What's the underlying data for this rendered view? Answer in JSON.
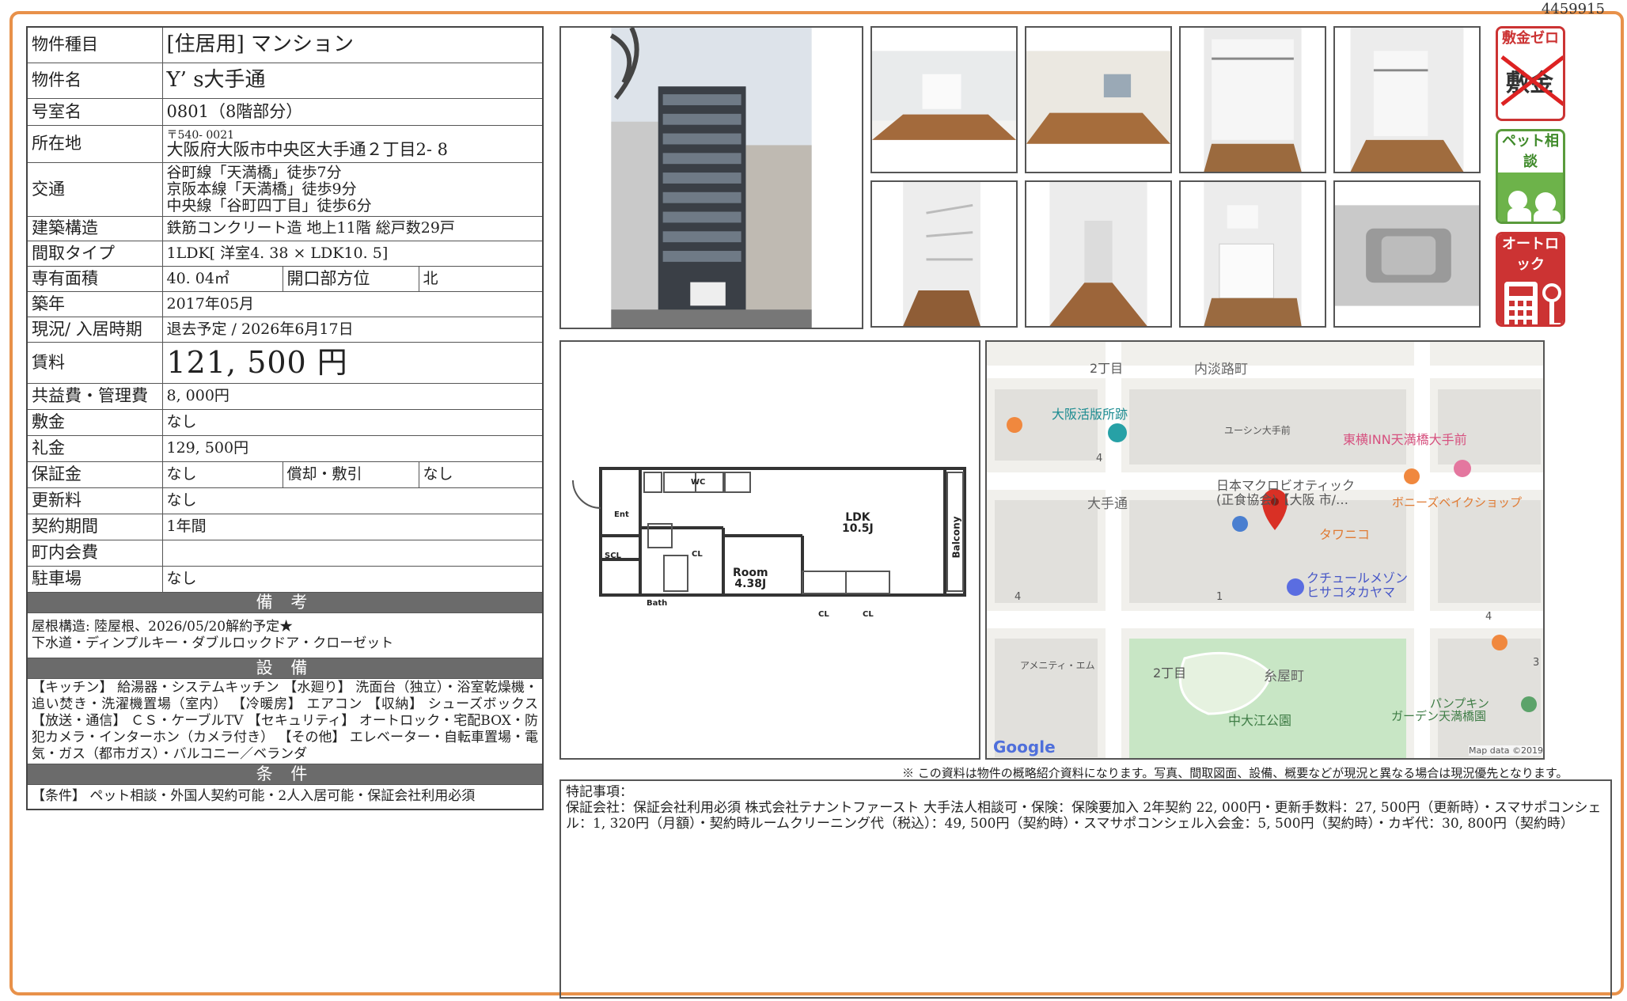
{
  "doc_id": "4459915",
  "property": {
    "type_label": "物件種目",
    "type_value": "[住居用] マンション",
    "name_label": "物件名",
    "name_value": "Y’ s大手通",
    "room_label": "号室名",
    "room_value": "0801（8階部分）",
    "address_label": "所在地",
    "postal": "〒540- 0021",
    "address": "大阪府大阪市中央区大手通２丁目2- 8",
    "transport_label": "交通",
    "transport": [
      "谷町線「天満橋」徒歩7分",
      "京阪本線「天満橋」徒歩9分",
      "中央線「谷町四丁目」徒歩6分"
    ],
    "structure_label": "建築構造",
    "structure_value": "鉄筋コンクリート造 地上11階 総戸数29戸",
    "layout_label": "間取タイプ",
    "layout_value": "1LDK[ 洋室4. 38 × LDK10. 5]",
    "area_label": "専有面積",
    "area_value": "40. 04㎡",
    "opening_label": "開口部方位",
    "opening_value": "北",
    "built_label": "築年",
    "built_value": "2017年05月",
    "status_label": "現況/ 入居時期",
    "status_value": "退去予定 / 2026年6月17日",
    "rent_label": "賃料",
    "rent_value": "121, 500 円",
    "common_label": "共益費・管理費",
    "common_value": "8, 000円",
    "deposit_label": "敷金",
    "deposit_value": "なし",
    "keymoney_label": "礼金",
    "keymoney_value": "129, 500円",
    "guarantee_label": "保証金",
    "guarantee_value": "なし",
    "amort_label": "償却・敷引",
    "amort_value": "なし",
    "renewal_label": "更新料",
    "renewal_value": "なし",
    "contract_label": "契約期間",
    "contract_value": "1年間",
    "assoc_label": "町内会費",
    "assoc_value": "",
    "parking_label": "駐車場",
    "parking_value": "なし",
    "remarks_header": "備 考",
    "remarks": [
      "屋根構造: 陸屋根、2026/05/20解約予定★",
      "下水道・ディンプルキー・ダブルロックドア・クローゼット"
    ],
    "equipment_header": "設 備",
    "equipment": "【キッチン】 給湯器・システムキッチン 【水廻り】 洗面台（独立）・浴室乾燥機・追い焚き・洗濯機置場（室内） 【冷暖房】 エアコン 【収納】 シューズボックス 【放送・通信】 ＣＳ・ケーブルTV 【セキュリティ】 オートロック・宅配BOX・防犯カメラ・インターホン（カメラ付き） 【その他】 エレベーター・自転車置場・電気・ガス（都市ガス）・バルコニー／ベランダ",
    "conditions_header": "条 件",
    "conditions": "【条件】 ペット相談・外国人契約可能・2人入居可能・保証会社利用必須"
  },
  "badges": {
    "zero": "敷金ゼロ",
    "zero_mark": "敷金",
    "pet": "ペット相談",
    "lock": "オートロック"
  },
  "floorplan": {
    "ldk": "LDK",
    "ldk_size": "10.5J",
    "room": "Room",
    "room_size": "4.38J",
    "balcony": "Balcony",
    "ent": "Ent",
    "wc": "WC",
    "scl": "SCL",
    "cl": "CL",
    "bath": "Bath"
  },
  "map": {
    "labels": [
      "2丁目",
      "内淡路町",
      "大阪活版所跡",
      "ユーシン大手前",
      "東横INN天満橋大手前",
      "大手通",
      "日本マクロビオティック",
      "(正食協会)【大阪 市/…",
      "ボニーズベイクショップ",
      "タワニコ",
      "クチュールメゾン",
      "ヒサコタカヤマ",
      "アメニティ・エム",
      "2丁目",
      "糸屋町",
      "中大江公園",
      "パンプキン",
      "ガーデン天満橋園",
      "4",
      "4",
      "1",
      "4",
      "3"
    ],
    "google": "Google",
    "mapdata": "Map data ©2019"
  },
  "disclaimer": "※ この資料は物件の概略紹介資料になります。写真、間取図面、設備、概要などが現況と異なる場合は現況優先となります。",
  "notes_title": "特記事項：",
  "notes_body": "保証会社：保証会社利用必須 株式会社テナントファースト 大手法人相談可・保険：保険要加入 2年契約 22, 000円・更新手数料：27, 500円（更新時）・スマサポコンシェル：1, 320円（月額）・契約時ルームクリーニング代（税込）：49, 500円（契約時）・スマサポコンシェル入会金：5, 500円（契約時）・カギ代：30, 800円（契約時）"
}
